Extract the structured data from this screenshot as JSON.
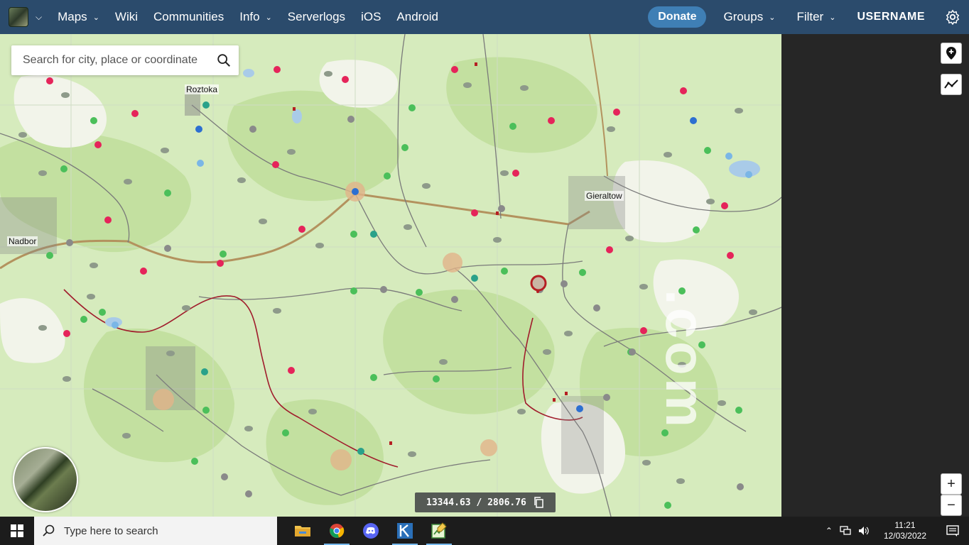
{
  "nav": {
    "items": [
      "Maps",
      "Wiki",
      "Communities",
      "Info",
      "Serverlogs",
      "iOS",
      "Android"
    ],
    "donate": "Donate",
    "groups": "Groups",
    "filter": "Filter",
    "username": "USERNAME"
  },
  "search": {
    "placeholder": "Search for city, place or coordinate"
  },
  "map": {
    "towns": [
      "Roztoka",
      "Gieraltow",
      "Nadbor"
    ],
    "watermark": ".com",
    "coordinates": "13344.63 / 2806.76"
  },
  "controls": {
    "zoom_in": "+",
    "zoom_out": "−"
  },
  "taskbar": {
    "search_placeholder": "Type here to search",
    "time": "11:21",
    "date": "12/03/2022"
  },
  "colors": {
    "navbar": "#2b4b6c",
    "donate": "#3f7fb5",
    "forest": "#c9e4a7",
    "field": "#f4f4ee"
  }
}
